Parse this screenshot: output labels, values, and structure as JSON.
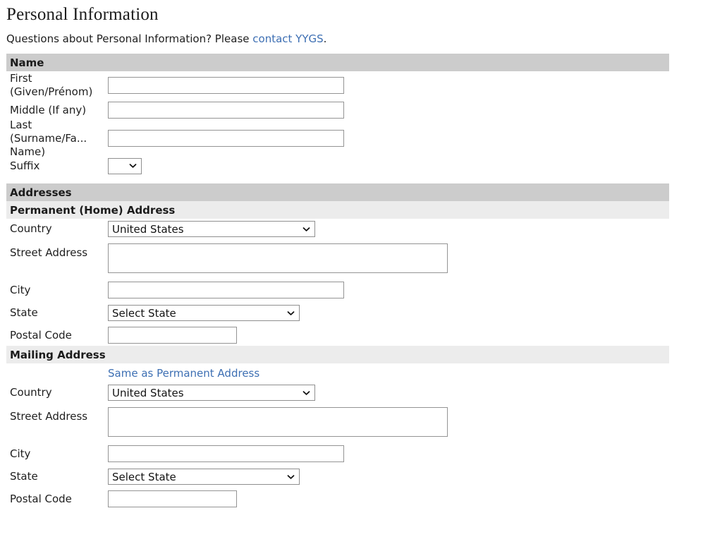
{
  "page": {
    "title": "Personal Information",
    "intro_prefix": "Questions about Personal Information? Please ",
    "intro_link": "contact YYGS",
    "intro_suffix": "."
  },
  "name_section": {
    "heading": "Name",
    "fields": {
      "first_label": "First (Given/Prénom)",
      "first_value": "",
      "middle_label": "Middle (If any)",
      "middle_value": "",
      "last_label": "Last (Surname/Fa... Name)",
      "last_value": "",
      "suffix_label": "Suffix",
      "suffix_value": ""
    }
  },
  "addresses_section": {
    "heading": "Addresses",
    "permanent": {
      "heading": "Permanent (Home) Address",
      "country_label": "Country",
      "country_value": "United States",
      "street_label": "Street Address",
      "street_value": "",
      "city_label": "City",
      "city_value": "",
      "state_label": "State",
      "state_value": "Select State",
      "postal_label": "Postal Code",
      "postal_value": ""
    },
    "mailing": {
      "heading": "Mailing Address",
      "same_as_permanent_link": "Same as Permanent Address",
      "country_label": "Country",
      "country_value": "United States",
      "street_label": "Street Address",
      "street_value": "",
      "city_label": "City",
      "city_value": "",
      "state_label": "State",
      "state_value": "Select State",
      "postal_label": "Postal Code",
      "postal_value": ""
    }
  },
  "icons": {
    "dropdown": "chevron-down-icon"
  },
  "colors": {
    "link": "#3d6fb3",
    "section_bar": "#cccccc",
    "subsection_bar": "#ececec",
    "field_border": "#949494"
  }
}
